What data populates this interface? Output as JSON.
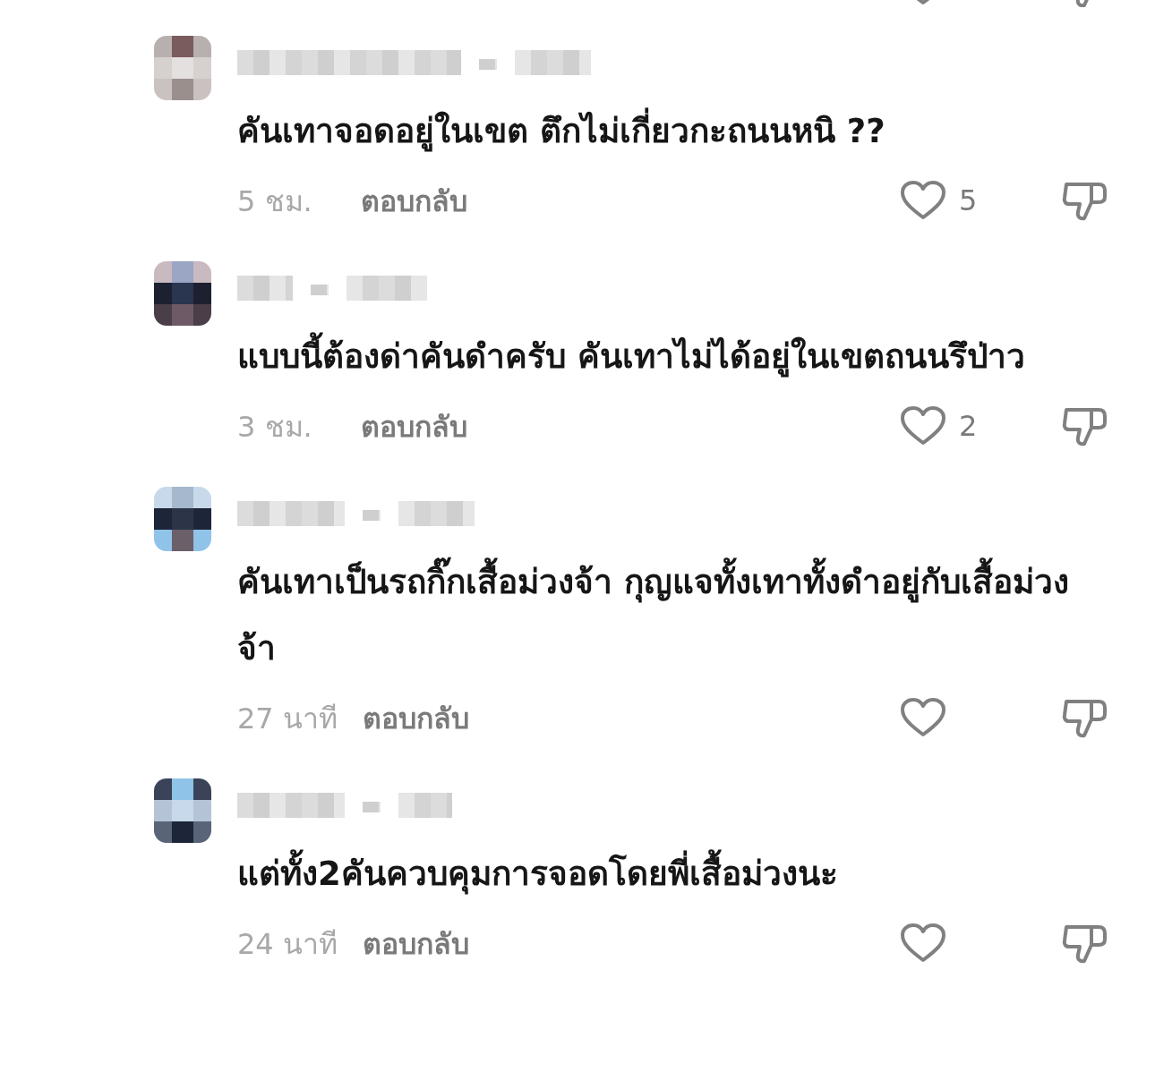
{
  "comments": [
    {
      "text": "คันเทาจอดอยู่ในเขต ตึกไม่เกี่ยวกะถนนหนิ ??",
      "time": "5 ชม.",
      "reply": "ตอบกลับ",
      "likes": "5"
    },
    {
      "text": "แบบนี้ต้องด่าคันดำครับ คันเทาไม่ได้อยู่ในเขตถนนรึป่าว",
      "time": "3 ชม.",
      "reply": "ตอบกลับ",
      "likes": "2"
    },
    {
      "text": "คันเทาเป็นรถกิ๊กเสื้อม่วงจ้า กุญแจทั้งเทาทั้งดำอยู่กับเสื้อม่วงจ้า",
      "time": "27 นาที",
      "reply": "ตอบกลับ"
    },
    {
      "text": "แต่ทั้ง2คันควบคุมการจอดโดยพี่เสื้อม่วงนะ",
      "time": "24 นาที",
      "reply": "ตอบกลับ"
    }
  ]
}
